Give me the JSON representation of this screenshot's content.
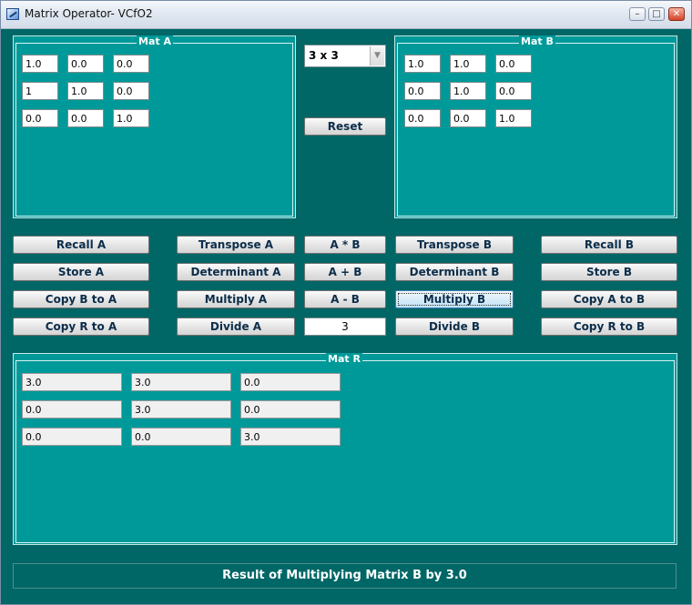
{
  "window": {
    "title": "Matrix Operator- VCfO2",
    "minimize_label": "–",
    "maximize_label": "□",
    "close_label": "✕"
  },
  "mat_a": {
    "label": "Mat A",
    "rows": [
      [
        "1.0",
        "0.0",
        "0.0"
      ],
      [
        "1",
        "1.0",
        "0.0"
      ],
      [
        "0.0",
        "0.0",
        "1.0"
      ]
    ]
  },
  "mat_b": {
    "label": "Mat B",
    "rows": [
      [
        "1.0",
        "1.0",
        "0.0"
      ],
      [
        "0.0",
        "1.0",
        "0.0"
      ],
      [
        "0.0",
        "0.0",
        "1.0"
      ]
    ]
  },
  "mat_r": {
    "label": "Mat R",
    "rows": [
      [
        "3.0",
        "3.0",
        "0.0"
      ],
      [
        "0.0",
        "3.0",
        "0.0"
      ],
      [
        "0.0",
        "0.0",
        "3.0"
      ]
    ]
  },
  "size_select": {
    "value": "3 x 3",
    "arrow": "▼"
  },
  "reset_label": "Reset",
  "scalar_value": "3",
  "buttons": {
    "recall_a": "Recall A",
    "store_a": "Store A",
    "copy_b_to_a": "Copy B to A",
    "copy_r_to_a": "Copy R to A",
    "transpose_a": "Transpose A",
    "determinant_a": "Determinant A",
    "multiply_a": "Multiply A",
    "divide_a": "Divide A",
    "a_times_b": "A * B",
    "a_plus_b": "A + B",
    "a_minus_b": "A - B",
    "transpose_b": "Transpose B",
    "determinant_b": "Determinant B",
    "multiply_b": "Multiply B",
    "divide_b": "Divide B",
    "recall_b": "Recall B",
    "store_b": "Store B",
    "copy_a_to_b": "Copy A to B",
    "copy_r_to_b": "Copy R to B"
  },
  "status_text": "Result of Multiplying Matrix B by 3.0"
}
